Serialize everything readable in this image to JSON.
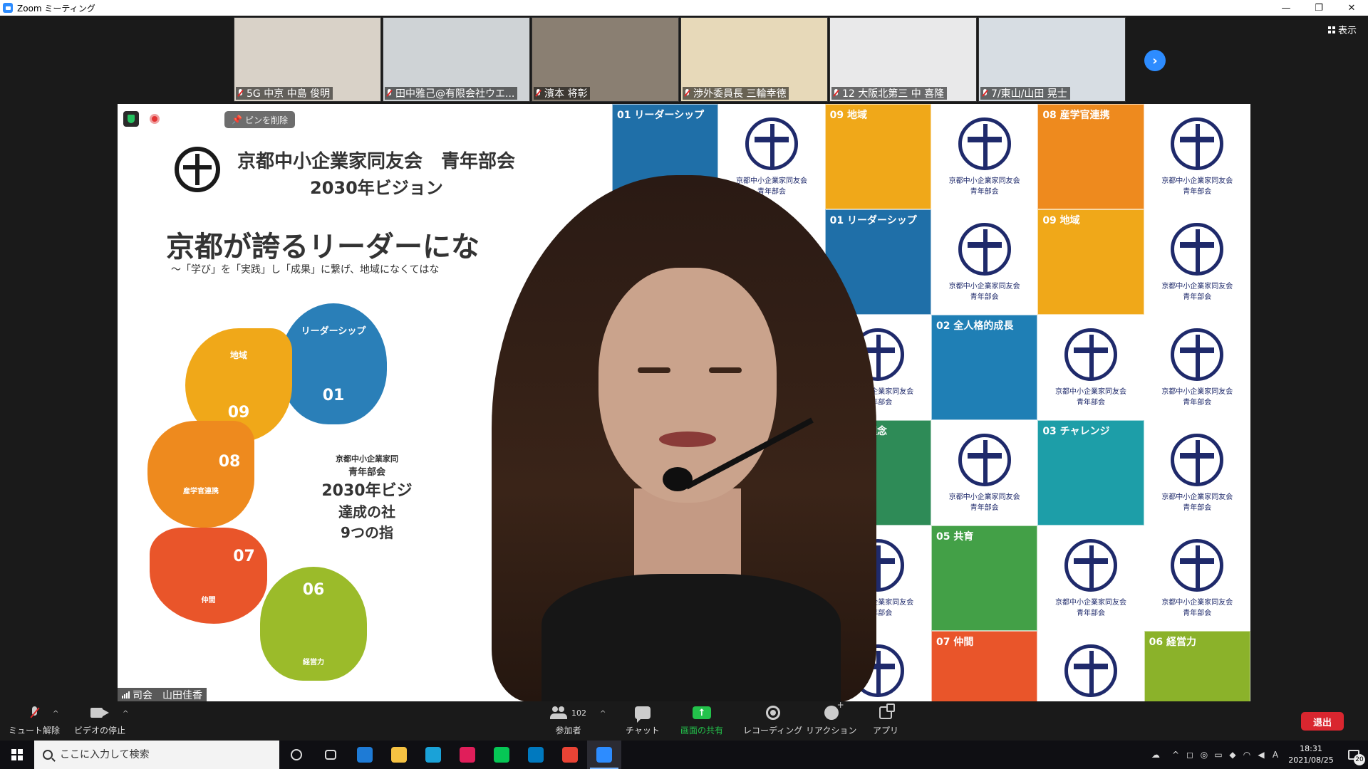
{
  "window": {
    "title": "Zoom ミーティング",
    "minimize": "—",
    "maximize": "❐",
    "close": "✕"
  },
  "view_button": "表示",
  "participants": [
    {
      "name": "5G 中京 中島 俊明",
      "bg": "#d9d2c8"
    },
    {
      "name": "田中雅己@有限会社ウエ...",
      "bg": "#cfd3d6"
    },
    {
      "name": "濱本 将彰",
      "bg": "#8a7f72"
    },
    {
      "name": "渉外委員長 三輪幸徳",
      "bg": "#e7d9b9"
    },
    {
      "name": "12 大阪北第三 中 喜隆",
      "bg": "#e9e9ea"
    },
    {
      "name": "7/東山/山田 晃士",
      "bg": "#d7dde3"
    }
  ],
  "main_video": {
    "pin_label": "ピンを削除",
    "speaker_name": "司会　山田佳香"
  },
  "slide": {
    "org": "京都中小企業家同友会　青年部会",
    "vision": "2030年ビジョン",
    "headline": "京都が誇るリーダーにな",
    "sub": "〜「学び」を「実践」し「成果」に繋げ、地域になくてはな",
    "petals": [
      {
        "label": "リーダーシップ",
        "num": "01",
        "color": "#2a7fb8"
      },
      {
        "label": "地域",
        "num": "09",
        "color": "#f0a819"
      },
      {
        "label": "産学官連携",
        "num": "08",
        "color": "#ee8a1e"
      },
      {
        "label": "仲間",
        "num": "07",
        "color": "#e9552a"
      },
      {
        "label": "経営力",
        "num": "06",
        "color": "#9bbb2a"
      }
    ],
    "center": {
      "l1": "京都中小企業家同",
      "l2": "青年部会",
      "l3": "2030年ビジ",
      "l4": "達成の社",
      "l5": "9つの指"
    },
    "tiles": [
      {
        "type": "color",
        "tag": "01 リーダーシップ",
        "color": "#1f6fa8"
      },
      {
        "type": "logo"
      },
      {
        "type": "color",
        "tag": "09 地域",
        "color": "#f0a819"
      },
      {
        "type": "logo"
      },
      {
        "type": "color",
        "tag": "08 産学官連携",
        "color": "#ee8a1e"
      },
      {
        "type": "logo"
      },
      {
        "type": "color",
        "tag": "02 全人格的成長",
        "color": "#1f7fb5"
      },
      {
        "type": "logo"
      },
      {
        "type": "color",
        "tag": "01 リーダーシップ",
        "color": "#1f6fa8"
      },
      {
        "type": "logo"
      },
      {
        "type": "color",
        "tag": "09 地域",
        "color": "#f0a819"
      },
      {
        "type": "logo"
      },
      {
        "type": "logo"
      },
      {
        "type": "color",
        "tag": "03 チャレンジ",
        "color": "#1d9ea8"
      },
      {
        "type": "logo"
      },
      {
        "type": "color",
        "tag": "02 全人格的成長",
        "color": "#1f7fb5"
      },
      {
        "type": "logo"
      },
      {
        "type": "logo"
      },
      {
        "type": "color",
        "tag": "共育",
        "color": "#43a047"
      },
      {
        "type": "logo"
      },
      {
        "type": "color",
        "tag": "04 経営理念",
        "color": "#2e8b57"
      },
      {
        "type": "logo"
      },
      {
        "type": "color",
        "tag": "03 チャレンジ",
        "color": "#1d9ea8"
      },
      {
        "type": "logo"
      },
      {
        "type": "logo"
      },
      {
        "type": "color",
        "tag": "06 経営力",
        "color": "#8bb22a"
      },
      {
        "type": "logo"
      },
      {
        "type": "color",
        "tag": "05 共育",
        "color": "#43a047"
      },
      {
        "type": "logo"
      },
      {
        "type": "logo"
      },
      {
        "type": "logo"
      },
      {
        "type": "logo"
      },
      {
        "type": "logo"
      },
      {
        "type": "color",
        "tag": "07 仲間",
        "color": "#e9552a"
      },
      {
        "type": "logo"
      },
      {
        "type": "color",
        "tag": "06 経営力",
        "color": "#8bb22a"
      }
    ],
    "tile_logo_caption_1": "京都中小企業家同友会",
    "tile_logo_caption_2": "青年部会"
  },
  "toolbar": {
    "mute": "ミュート解除",
    "video": "ビデオの停止",
    "participants": "参加者",
    "participant_count": "102",
    "chat": "チャット",
    "share": "画面の共有",
    "record": "レコーディング",
    "reactions": "リアクション",
    "apps": "アプリ",
    "leave": "退出"
  },
  "taskbar": {
    "search_placeholder": "ここに入力して検索",
    "time": "18:31",
    "date": "2021/08/25",
    "notifications": "20",
    "ime": "A",
    "apps": [
      {
        "name": "task-view",
        "color": "#0f0f13"
      },
      {
        "name": "widgets",
        "color": "#0f0f13"
      },
      {
        "name": "bw",
        "color": "#1e7bd6"
      },
      {
        "name": "explorer",
        "color": "#f5c242"
      },
      {
        "name": "edge",
        "color": "#1aa2d8"
      },
      {
        "name": "slack",
        "color": "#e01e5a"
      },
      {
        "name": "line",
        "color": "#06c755"
      },
      {
        "name": "trello",
        "color": "#0079bf"
      },
      {
        "name": "chrome",
        "color": "#e94335"
      },
      {
        "name": "zoom",
        "color": "#2d8cff"
      }
    ]
  }
}
